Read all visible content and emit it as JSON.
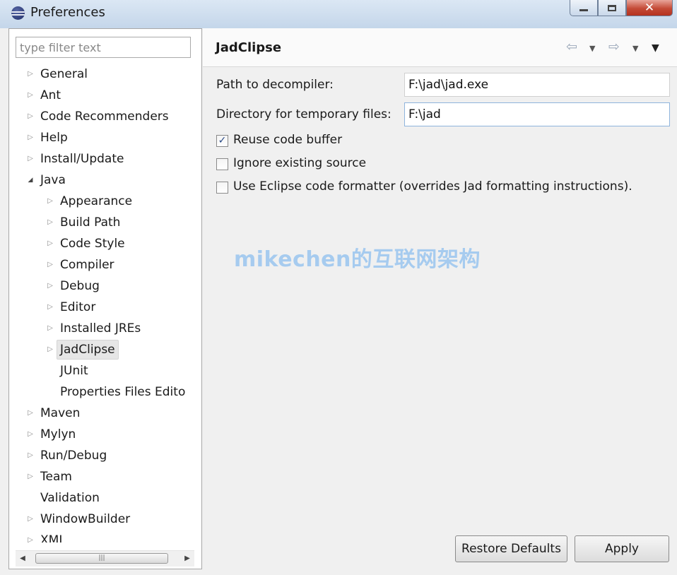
{
  "window": {
    "title": "Preferences"
  },
  "filter": {
    "placeholder": "type filter text",
    "value": ""
  },
  "tree": {
    "items": [
      {
        "label": "General",
        "level": 0,
        "expander": "collapsed"
      },
      {
        "label": "Ant",
        "level": 0,
        "expander": "collapsed"
      },
      {
        "label": "Code Recommenders",
        "level": 0,
        "expander": "collapsed"
      },
      {
        "label": "Help",
        "level": 0,
        "expander": "collapsed"
      },
      {
        "label": "Install/Update",
        "level": 0,
        "expander": "collapsed"
      },
      {
        "label": "Java",
        "level": 0,
        "expander": "expanded"
      },
      {
        "label": "Appearance",
        "level": 1,
        "expander": "collapsed"
      },
      {
        "label": "Build Path",
        "level": 1,
        "expander": "collapsed"
      },
      {
        "label": "Code Style",
        "level": 1,
        "expander": "collapsed"
      },
      {
        "label": "Compiler",
        "level": 1,
        "expander": "collapsed"
      },
      {
        "label": "Debug",
        "level": 1,
        "expander": "collapsed"
      },
      {
        "label": "Editor",
        "level": 1,
        "expander": "collapsed"
      },
      {
        "label": "Installed JREs",
        "level": 1,
        "expander": "collapsed"
      },
      {
        "label": "JadClipse",
        "level": 1,
        "expander": "collapsed",
        "selected": true
      },
      {
        "label": "JUnit",
        "level": 1,
        "expander": "none"
      },
      {
        "label": "Properties Files Edito",
        "level": 1,
        "expander": "none"
      },
      {
        "label": "Maven",
        "level": 0,
        "expander": "collapsed"
      },
      {
        "label": "Mylyn",
        "level": 0,
        "expander": "collapsed"
      },
      {
        "label": "Run/Debug",
        "level": 0,
        "expander": "collapsed"
      },
      {
        "label": "Team",
        "level": 0,
        "expander": "collapsed"
      },
      {
        "label": "Validation",
        "level": 0,
        "expander": "none"
      },
      {
        "label": "WindowBuilder",
        "level": 0,
        "expander": "collapsed"
      },
      {
        "label": "XML",
        "level": 0,
        "expander": "collapsed"
      }
    ]
  },
  "page": {
    "title": "JadClipse",
    "fields": {
      "decompiler": {
        "label": "Path to decompiler:",
        "value": "F:\\jad\\jad.exe"
      },
      "tempdir": {
        "label": "Directory for temporary files:",
        "value": "F:\\jad"
      }
    },
    "options": {
      "reuse": {
        "label": "Reuse code buffer",
        "checked": true
      },
      "ignore": {
        "label": "Ignore existing source",
        "checked": false
      },
      "formatter": {
        "label": "Use Eclipse code formatter (overrides Jad formatting instructions).",
        "checked": false
      }
    },
    "buttons": {
      "restore": "Restore Defaults",
      "apply": "Apply"
    }
  },
  "watermark": "mikechen的互联网架构",
  "icons": {
    "app": "eclipse-icon",
    "back": "back-arrow-icon",
    "forward": "forward-arrow-icon",
    "menu": "view-menu-icon",
    "collapsed": "tree-collapsed-icon",
    "expanded": "tree-expanded-icon"
  },
  "colors": {
    "watermark": "#9ec8ef",
    "close_button": "#c44a36",
    "titlebar": "#c4d6ea"
  }
}
